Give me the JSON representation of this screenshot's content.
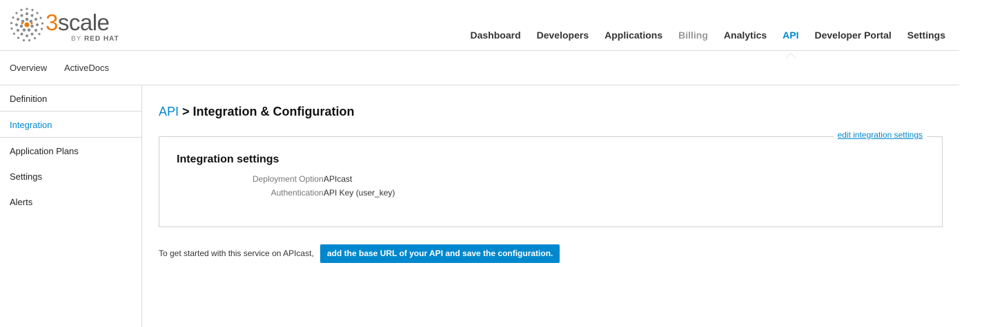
{
  "brand": {
    "word_prefix": "3",
    "word_rest": "scale",
    "byline_prefix": "BY ",
    "byline_company": "RED HAT",
    "accent_color": "#ee7a0f"
  },
  "main_nav": {
    "dashboard": "Dashboard",
    "developers": "Developers",
    "applications": "Applications",
    "billing": "Billing",
    "analytics": "Analytics",
    "api": "API",
    "developer_portal": "Developer Portal",
    "settings": "Settings",
    "active": "API",
    "disabled": "Billing"
  },
  "sub_nav": {
    "overview": "Overview",
    "activedocs": "ActiveDocs"
  },
  "sidebar": {
    "definition": "Definition",
    "integration": "Integration",
    "application_plans": "Application Plans",
    "settings": "Settings",
    "alerts": "Alerts",
    "active": "Integration"
  },
  "page": {
    "breadcrumb_link": "API",
    "title_rest": " > Integration & Configuration"
  },
  "integration": {
    "edit_link": "edit integration settings",
    "title": "Integration settings",
    "deployment_label": "Deployment Option:",
    "deployment_value": "APIcast",
    "auth_label": "Authentication:",
    "auth_value": "API Key (user_key)"
  },
  "cta": {
    "text": "To get started with this service on APIcast,",
    "button": "add the base URL of your API and save the configuration."
  },
  "colors": {
    "link": "#0088ce",
    "button_bg": "#0088ce",
    "border": "#d9d9d9"
  }
}
